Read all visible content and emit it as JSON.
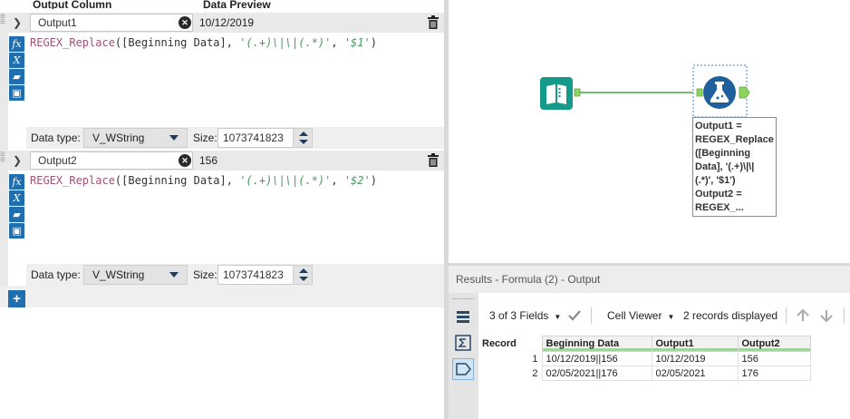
{
  "formula_panel": {
    "column_headers": {
      "output_column": "Output Column",
      "data_preview": "Data Preview"
    },
    "expressions": [
      {
        "output_name": "Output1",
        "preview": "10/12/2019",
        "code": {
          "fn": "REGEX_Replace",
          "open": "(",
          "field": "[Beginning Data]",
          "sep1": ", ",
          "pattern": "'(.+)\\|\\|(.*)'",
          "sep2": ", ",
          "replace": "'$1'",
          "close": ")"
        },
        "data_type_label": "Data type:",
        "data_type": "V_WString",
        "size_label": "Size:",
        "size": "1073741823"
      },
      {
        "output_name": "Output2",
        "preview": "156",
        "code": {
          "fn": "REGEX_Replace",
          "open": "(",
          "field": "[Beginning Data]",
          "sep1": ", ",
          "pattern": "'(.+)\\|\\|(.*)'",
          "sep2": ", ",
          "replace": "'$2'",
          "close": ")"
        },
        "data_type_label": "Data type:",
        "data_type": "V_WString",
        "size_label": "Size:",
        "size": "1073741823"
      }
    ],
    "add_button": "+"
  },
  "canvas": {
    "annotation": "Output1 =\nREGEX_Replace\n([Beginning\nData], '(.+)\\|\\|\n(.*)', '$1')\nOutput2 =\nREGEX_..."
  },
  "results": {
    "title": "Results - Formula (2) - Output",
    "fields_label": "3 of 3 Fields",
    "cell_viewer_label": "Cell Viewer",
    "records_label": "2 records displayed",
    "columns": [
      "Record",
      "Beginning Data",
      "Output1",
      "Output2"
    ],
    "rows": [
      [
        "1",
        "10/12/2019||156",
        "10/12/2019",
        "156"
      ],
      [
        "2",
        "02/05/2021||176",
        "02/05/2021",
        "176"
      ]
    ]
  },
  "colors": {
    "accent": "#1f6fb0",
    "tool_teal": "#159a8a",
    "tool_blue": "#1f5f9c",
    "connector_green": "#8fd460"
  }
}
